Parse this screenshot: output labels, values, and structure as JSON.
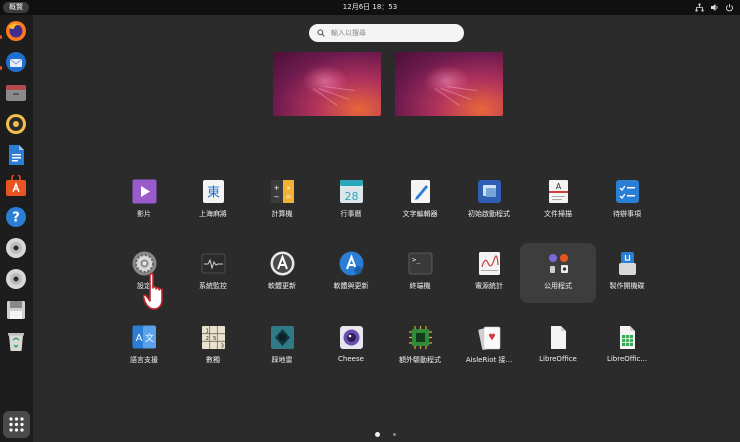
{
  "topbar": {
    "activities_label": "概覽",
    "clock": "12月6日 18：53"
  },
  "dock": {
    "items": [
      {
        "name": "firefox-icon"
      },
      {
        "name": "thunderbird-icon"
      },
      {
        "name": "files-icon"
      },
      {
        "name": "rhythmbox-icon"
      },
      {
        "name": "libreoffice-writer-icon"
      },
      {
        "name": "app-center-icon"
      },
      {
        "name": "help-icon"
      },
      {
        "name": "optical-disc-icon"
      },
      {
        "name": "optical-disc-icon"
      },
      {
        "name": "floppy-save-icon"
      },
      {
        "name": "trash-icon"
      }
    ]
  },
  "search": {
    "placeholder": "輸入以搜尋"
  },
  "apps": [
    {
      "label": "影片",
      "icon": "videos-icon"
    },
    {
      "label": "上海麻將",
      "icon": "mahjongg-icon"
    },
    {
      "label": "計算機",
      "icon": "calculator-icon"
    },
    {
      "label": "行事曆",
      "icon": "calendar-icon"
    },
    {
      "label": "文字編輯器",
      "icon": "text-editor-icon"
    },
    {
      "label": "初始啟動程式",
      "icon": "startup-apps-icon"
    },
    {
      "label": "文件掃描",
      "icon": "document-scanner-icon"
    },
    {
      "label": "待辦事項",
      "icon": "todo-icon"
    },
    {
      "label": "設定",
      "icon": "settings-gear-icon"
    },
    {
      "label": "系統監控",
      "icon": "system-monitor-icon"
    },
    {
      "label": "軟體更新",
      "icon": "software-updater-icon"
    },
    {
      "label": "軟體與更新",
      "icon": "software-properties-icon"
    },
    {
      "label": "終端機",
      "icon": "terminal-icon"
    },
    {
      "label": "電源統計",
      "icon": "power-statistics-icon"
    },
    {
      "label": "公用程式",
      "icon": "utilities-folder-icon"
    },
    {
      "label": "製作開機碟",
      "icon": "startup-disk-creator-icon"
    },
    {
      "label": "語言支援",
      "icon": "language-support-icon"
    },
    {
      "label": "數獨",
      "icon": "sudoku-icon"
    },
    {
      "label": "踩地雷",
      "icon": "mines-icon"
    },
    {
      "label": "Cheese",
      "icon": "cheese-icon"
    },
    {
      "label": "額外驅動程式",
      "icon": "additional-drivers-icon"
    },
    {
      "label": "AisleRiot 接...",
      "icon": "aisleriot-icon"
    },
    {
      "label": "LibreOffice",
      "icon": "libreoffice-icon"
    },
    {
      "label": "LibreOffic...",
      "icon": "libreoffice-calc-icon"
    }
  ],
  "pages": {
    "current": 1,
    "total": 2
  },
  "colors": {
    "accent": "#e95420",
    "panel": "#101010",
    "background": "#2b2b2b"
  }
}
